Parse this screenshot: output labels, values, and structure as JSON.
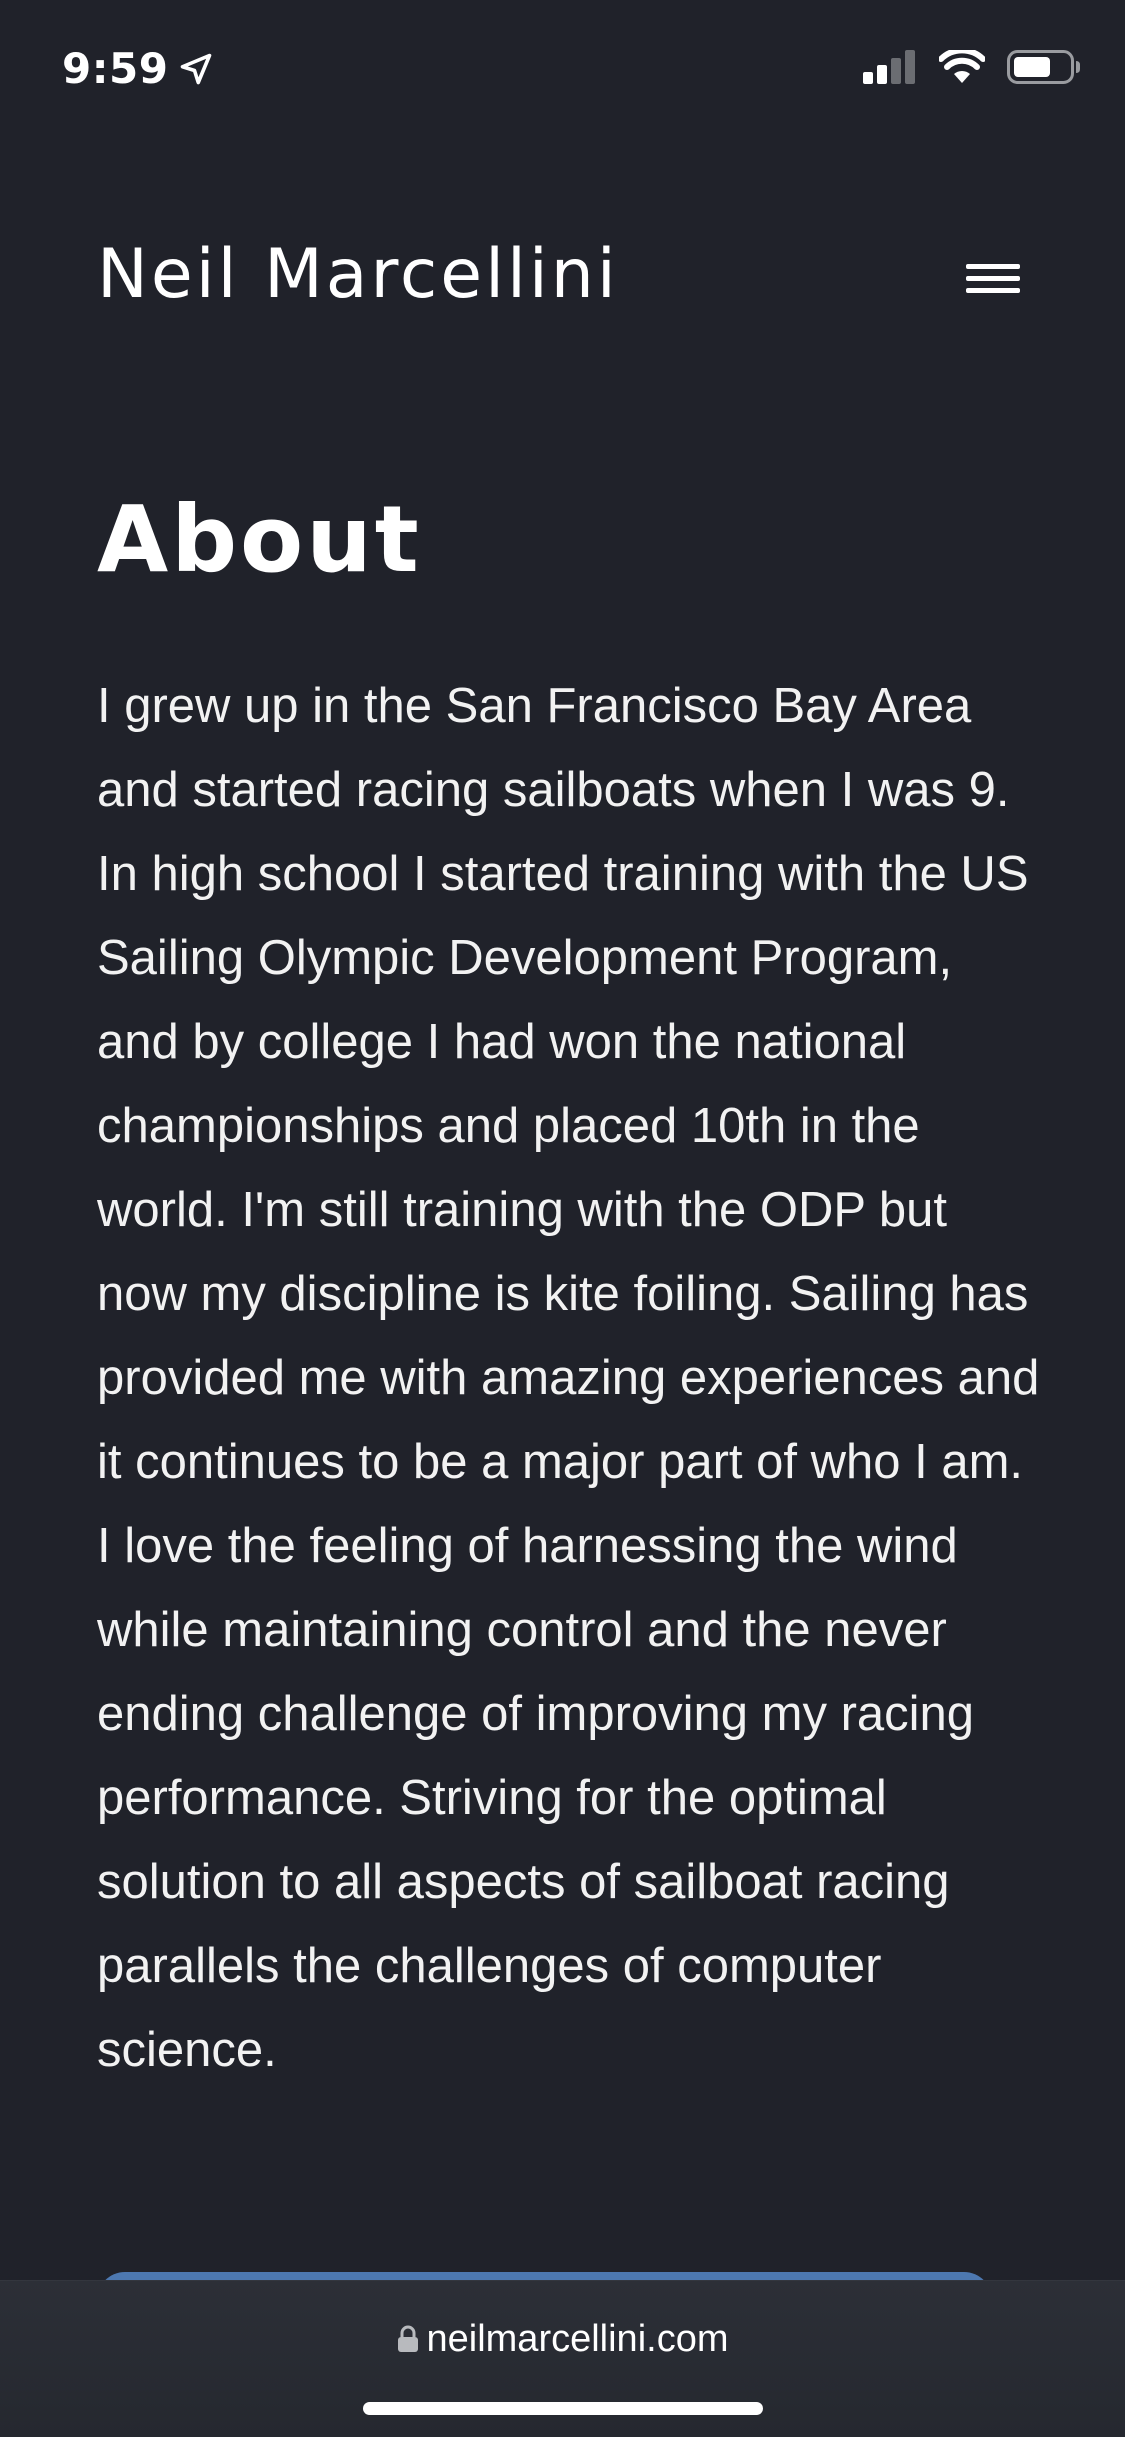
{
  "status_bar": {
    "time": "9:59",
    "icons": [
      "location-arrow-icon",
      "cellular-signal-icon",
      "wifi-icon",
      "battery-icon"
    ]
  },
  "header": {
    "site_title": "Neil Marcellini",
    "menu_icon": "hamburger-menu-icon"
  },
  "about": {
    "heading": "About",
    "body": "I grew up in the San Francisco Bay Area and started racing sailboats when I was 9. In high school I started training with the US Sailing Olympic Development Program, and by college I had won the national championships and placed 10th in the world. I'm still training with the ODP but now my discipline is kite foiling. Sailing has provided me with amazing experiences and it continues to be a major part of who I am. I love the feeling of harnessing the wind while maintaining control and the never ending challenge of improving my racing performance. Striving for the optimal solution to all aspects of sailboat racing parallels the challenges of computer science."
  },
  "browser": {
    "url": "neilmarcellini.com",
    "lock_icon": "lock-icon"
  },
  "colors": {
    "background": "#20222a",
    "text": "#ffffff",
    "accent": "#4d78b0",
    "toolbar": "#2c2f37"
  }
}
